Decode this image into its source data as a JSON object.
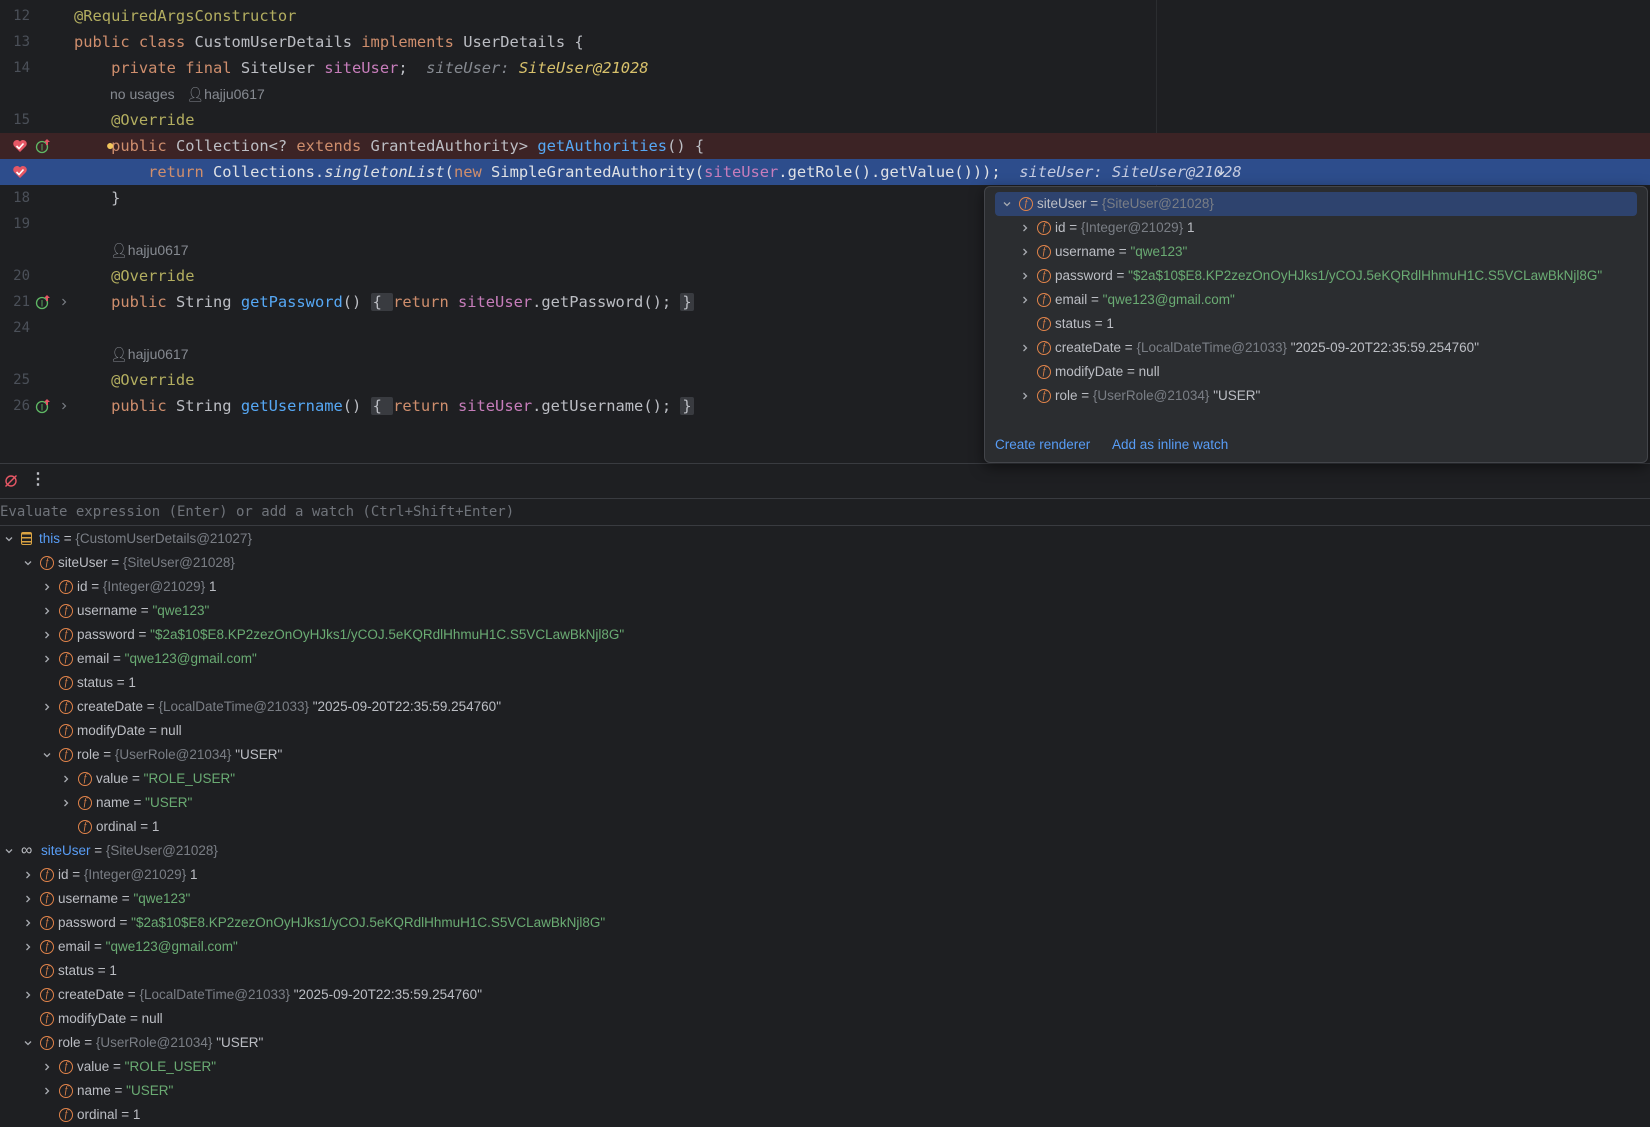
{
  "editor": {
    "lines": [
      {
        "num": "12",
        "parts": [
          {
            "t": "@RequiredArgsConstructor",
            "c": "ann"
          }
        ]
      },
      {
        "num": "13",
        "parts": [
          {
            "t": "public ",
            "c": "kw"
          },
          {
            "t": "class ",
            "c": "kw"
          },
          {
            "t": "CustomUserDetails ",
            "c": ""
          },
          {
            "t": "implements ",
            "c": "kw"
          },
          {
            "t": "UserDetails {",
            "c": ""
          }
        ]
      },
      {
        "num": "14",
        "parts": [
          {
            "t": "    private ",
            "c": "kw"
          },
          {
            "t": "final ",
            "c": "kw"
          },
          {
            "t": "SiteUser ",
            "c": ""
          },
          {
            "t": "siteUser",
            "c": "fld"
          },
          {
            "t": ";  ",
            "c": ""
          },
          {
            "t": "siteUser: ",
            "c": "inl"
          },
          {
            "t": "SiteUser@21028",
            "c": "inlv"
          }
        ]
      },
      {
        "num": "15",
        "parts": [
          {
            "t": "    @Override",
            "c": "ann"
          }
        ]
      },
      {
        "num": "",
        "parts": [
          {
            "t": "    public ",
            "c": "kw"
          },
          {
            "t": "Collection<? ",
            "c": ""
          },
          {
            "t": "extends ",
            "c": "kw"
          },
          {
            "t": "GrantedAuthority> ",
            "c": ""
          },
          {
            "t": "getAuthorities",
            "c": "fn"
          },
          {
            "t": "() {",
            "c": ""
          }
        ]
      },
      {
        "num": "",
        "parts": [
          {
            "t": "        return ",
            "c": "kw"
          },
          {
            "t": "Collections.",
            "c": ""
          },
          {
            "t": "singletonList",
            "c": "it"
          },
          {
            "t": "(",
            "c": ""
          },
          {
            "t": "new ",
            "c": "kw"
          },
          {
            "t": "SimpleGrantedAuthority(",
            "c": ""
          },
          {
            "t": "siteUser",
            "c": "fld"
          },
          {
            "t": ".getRole().getValue()));  ",
            "c": ""
          },
          {
            "t": "siteUser: SiteUser@21028",
            "c": "exec-inl"
          }
        ]
      },
      {
        "num": "18",
        "parts": [
          {
            "t": "    }",
            "c": ""
          }
        ]
      },
      {
        "num": "19",
        "parts": []
      },
      {
        "num": "20",
        "parts": [
          {
            "t": "    @Override",
            "c": "ann"
          }
        ]
      },
      {
        "num": "21",
        "parts": [
          {
            "t": "    public ",
            "c": "kw"
          },
          {
            "t": "String ",
            "c": ""
          },
          {
            "t": "getPassword",
            "c": "fn"
          },
          {
            "t": "() ",
            "c": ""
          },
          {
            "t": "{ ",
            "c": "fold"
          },
          {
            "t": "return ",
            "c": "kw"
          },
          {
            "t": "siteUser",
            "c": "fld"
          },
          {
            "t": ".getPassword(); ",
            "c": ""
          },
          {
            "t": "}",
            "c": "fold"
          }
        ]
      },
      {
        "num": "24",
        "parts": []
      },
      {
        "num": "25",
        "parts": [
          {
            "t": "    @Override",
            "c": "ann"
          }
        ]
      },
      {
        "num": "26",
        "parts": [
          {
            "t": "    public ",
            "c": "kw"
          },
          {
            "t": "String ",
            "c": ""
          },
          {
            "t": "getUsername",
            "c": "fn"
          },
          {
            "t": "() ",
            "c": ""
          },
          {
            "t": "{ ",
            "c": "fold"
          },
          {
            "t": "return ",
            "c": "kw"
          },
          {
            "t": "siteUser",
            "c": "fld"
          },
          {
            "t": ".getUsername(); ",
            "c": ""
          },
          {
            "t": "}",
            "c": "fold"
          }
        ]
      }
    ],
    "hint_usages": "no usages",
    "author": "hajju0617"
  },
  "popup": {
    "rows": [
      {
        "name": "siteUser",
        "eq": " = ",
        "type": "{SiteUser@21028}",
        "val": "",
        "expand": "open",
        "sel": true
      },
      {
        "name": "id",
        "eq": " = ",
        "type": "{Integer@21029}",
        "val": " 1",
        "vc": "num",
        "expand": "closed"
      },
      {
        "name": "username",
        "eq": " = ",
        "type": "",
        "val": "\"qwe123\"",
        "vc": "str",
        "expand": "closed"
      },
      {
        "name": "password",
        "eq": " = ",
        "type": "",
        "val": "\"$2a$10$E8.KP2zezOnOyHJks1/yCOJ.5eKQRdlHhmuH1C.S5VCLawBkNjl8G\"",
        "vc": "str",
        "expand": "closed"
      },
      {
        "name": "email",
        "eq": " = ",
        "type": "",
        "val": "\"qwe123@gmail.com\"",
        "vc": "str",
        "expand": "closed"
      },
      {
        "name": "status",
        "eq": " = ",
        "type": "",
        "val": "1",
        "vc": "num",
        "expand": "none"
      },
      {
        "name": "createDate",
        "eq": " = ",
        "type": "{LocalDateTime@21033}",
        "val": " \"2025-09-20T22:35:59.254760\"",
        "vc": "num",
        "expand": "closed"
      },
      {
        "name": "modifyDate",
        "eq": " = ",
        "type": "",
        "val": "null",
        "vc": "num",
        "expand": "none"
      },
      {
        "name": "role",
        "eq": " = ",
        "type": "{UserRole@21034}",
        "val": " \"USER\"",
        "vc": "num",
        "expand": "closed"
      }
    ],
    "create_renderer": "Create renderer",
    "add_inline_watch": "Add as inline watch"
  },
  "debug": {
    "eval_placeholder": "Evaluate expression (Enter) or add a watch (Ctrl+Shift+Enter)",
    "rows": [
      {
        "lvl": 0,
        "icon": "this",
        "name": "this",
        "eq": " = ",
        "type": "{CustomUserDetails@21027}",
        "val": "",
        "expand": "open"
      },
      {
        "lvl": 1,
        "icon": "f",
        "name": "siteUser",
        "eq": " = ",
        "type": "{SiteUser@21028}",
        "val": "",
        "expand": "open"
      },
      {
        "lvl": 2,
        "icon": "f",
        "name": "id",
        "eq": " = ",
        "type": "{Integer@21029}",
        "val": " 1",
        "vc": "num",
        "expand": "closed"
      },
      {
        "lvl": 2,
        "icon": "f",
        "name": "username",
        "eq": " = ",
        "type": "",
        "val": "\"qwe123\"",
        "vc": "str",
        "expand": "closed"
      },
      {
        "lvl": 2,
        "icon": "f",
        "name": "password",
        "eq": " = ",
        "type": "",
        "val": "\"$2a$10$E8.KP2zezOnOyHJks1/yCOJ.5eKQRdlHhmuH1C.S5VCLawBkNjl8G\"",
        "vc": "str",
        "expand": "closed"
      },
      {
        "lvl": 2,
        "icon": "f",
        "name": "email",
        "eq": " = ",
        "type": "",
        "val": "\"qwe123@gmail.com\"",
        "vc": "str",
        "expand": "closed"
      },
      {
        "lvl": 2,
        "icon": "f",
        "name": "status",
        "eq": " = ",
        "type": "",
        "val": "1",
        "vc": "num",
        "expand": "none"
      },
      {
        "lvl": 2,
        "icon": "f",
        "name": "createDate",
        "eq": " = ",
        "type": "{LocalDateTime@21033}",
        "val": " \"2025-09-20T22:35:59.254760\"",
        "vc": "num",
        "expand": "closed"
      },
      {
        "lvl": 2,
        "icon": "f",
        "name": "modifyDate",
        "eq": " = ",
        "type": "",
        "val": "null",
        "vc": "num",
        "expand": "none"
      },
      {
        "lvl": 2,
        "icon": "f",
        "name": "role",
        "eq": " = ",
        "type": "{UserRole@21034}",
        "val": " \"USER\"",
        "vc": "num",
        "expand": "open"
      },
      {
        "lvl": 3,
        "icon": "f",
        "name": "value",
        "eq": " = ",
        "type": "",
        "val": "\"ROLE_USER\"",
        "vc": "str",
        "expand": "closed"
      },
      {
        "lvl": 3,
        "icon": "f",
        "name": "name",
        "eq": " = ",
        "type": "",
        "val": "\"USER\"",
        "vc": "str",
        "expand": "closed"
      },
      {
        "lvl": 3,
        "icon": "f",
        "name": "ordinal",
        "eq": " = ",
        "type": "",
        "val": "1",
        "vc": "num",
        "expand": "none"
      },
      {
        "lvl": 0,
        "icon": "watch",
        "name": "siteUser",
        "eq": " = ",
        "type": "{SiteUser@21028}",
        "val": "",
        "expand": "open",
        "blue": true
      },
      {
        "lvl": 1,
        "icon": "f",
        "name": "id",
        "eq": " = ",
        "type": "{Integer@21029}",
        "val": " 1",
        "vc": "num",
        "expand": "closed"
      },
      {
        "lvl": 1,
        "icon": "f",
        "name": "username",
        "eq": " = ",
        "type": "",
        "val": "\"qwe123\"",
        "vc": "str",
        "expand": "closed"
      },
      {
        "lvl": 1,
        "icon": "f",
        "name": "password",
        "eq": " = ",
        "type": "",
        "val": "\"$2a$10$E8.KP2zezOnOyHJks1/yCOJ.5eKQRdlHhmuH1C.S5VCLawBkNjl8G\"",
        "vc": "str",
        "expand": "closed"
      },
      {
        "lvl": 1,
        "icon": "f",
        "name": "email",
        "eq": " = ",
        "type": "",
        "val": "\"qwe123@gmail.com\"",
        "vc": "str",
        "expand": "closed"
      },
      {
        "lvl": 1,
        "icon": "f",
        "name": "status",
        "eq": " = ",
        "type": "",
        "val": "1",
        "vc": "num",
        "expand": "none"
      },
      {
        "lvl": 1,
        "icon": "f",
        "name": "createDate",
        "eq": " = ",
        "type": "{LocalDateTime@21033}",
        "val": " \"2025-09-20T22:35:59.254760\"",
        "vc": "num",
        "expand": "closed"
      },
      {
        "lvl": 1,
        "icon": "f",
        "name": "modifyDate",
        "eq": " = ",
        "type": "",
        "val": "null",
        "vc": "num",
        "expand": "none"
      },
      {
        "lvl": 1,
        "icon": "f",
        "name": "role",
        "eq": " = ",
        "type": "{UserRole@21034}",
        "val": " \"USER\"",
        "vc": "num",
        "expand": "open"
      },
      {
        "lvl": 2,
        "icon": "f",
        "name": "value",
        "eq": " = ",
        "type": "",
        "val": "\"ROLE_USER\"",
        "vc": "str",
        "expand": "closed"
      },
      {
        "lvl": 2,
        "icon": "f",
        "name": "name",
        "eq": " = ",
        "type": "",
        "val": "\"USER\"",
        "vc": "str",
        "expand": "closed"
      },
      {
        "lvl": 2,
        "icon": "f",
        "name": "ordinal",
        "eq": " = ",
        "type": "",
        "val": "1",
        "vc": "num",
        "expand": "none"
      }
    ]
  },
  "colors": {
    "background": "#1e1f22",
    "exec_line": "#2d4d8c",
    "breakpoint_line": "#3c2325",
    "string": "#6aab73",
    "keyword": "#cf8e6d",
    "link": "#589df6"
  }
}
